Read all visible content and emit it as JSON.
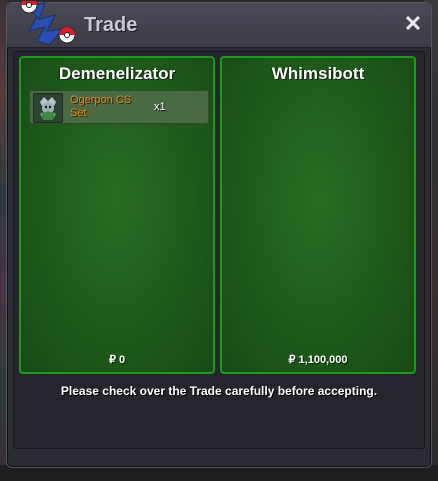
{
  "window": {
    "title": "Trade",
    "close_glyph": "✕"
  },
  "left_party": {
    "name": "Demenelizator",
    "items": [
      {
        "name": "Ogerpon CS Set",
        "quantity": "x1",
        "icon": "ogerpon-icon"
      }
    ],
    "money_symbol": "₽",
    "money": "0"
  },
  "right_party": {
    "name": "Whimsibott",
    "items": [],
    "money_symbol": "₽",
    "money": "1,100,000"
  },
  "footer": {
    "notice": "Please check over the Trade carefully before accepting."
  },
  "colors": {
    "panel_border": "#1c9a1c",
    "panel_fill": "#1e5a1a",
    "item_name": "#e08a1e",
    "window_bg": "#2b2b34"
  }
}
